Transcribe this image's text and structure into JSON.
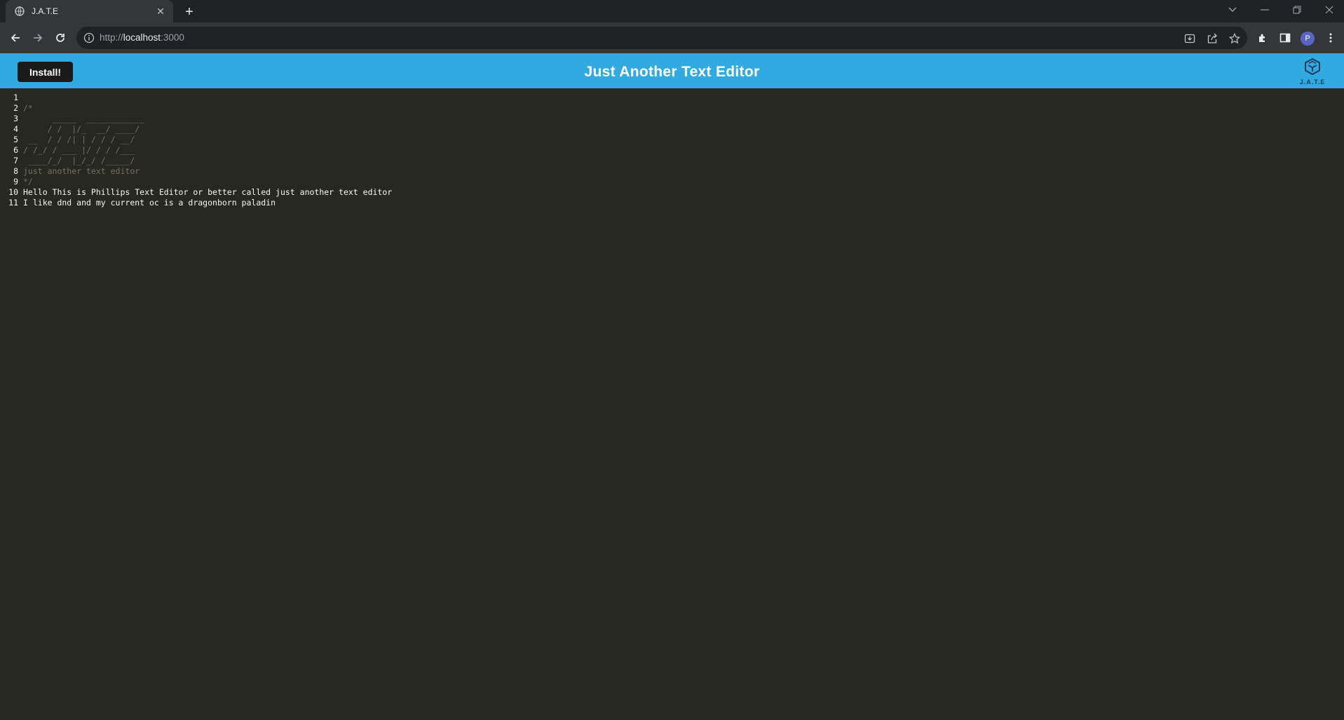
{
  "browser": {
    "tab_title": "J.A.T.E",
    "url_scheme": "http://",
    "url_host": "localhost",
    "url_port": ":3000",
    "profile_initial": "P"
  },
  "app": {
    "install_label": "Install!",
    "title": "Just Another Text Editor",
    "logo_text": "J.A.T.E"
  },
  "editor": {
    "lines": [
      {
        "num": "1",
        "text": "",
        "style": "normal"
      },
      {
        "num": "2",
        "text": "/*",
        "style": "comment"
      },
      {
        "num": "3",
        "text": "      _____  ____________",
        "style": "comment"
      },
      {
        "num": "4",
        "text": "     / /  |/_  __/ ____/",
        "style": "comment"
      },
      {
        "num": "5",
        "text": " __  / / /| | / / / __/",
        "style": "comment"
      },
      {
        "num": "6",
        "text": "/ /_/ / ___ |/ / / /___",
        "style": "comment"
      },
      {
        "num": "7",
        "text": " ____/_/  |_/_/ /_____/",
        "style": "comment"
      },
      {
        "num": "8",
        "text": "just another text editor",
        "style": "comment"
      },
      {
        "num": "9",
        "text": "*/",
        "style": "comment"
      },
      {
        "num": "10",
        "text": "Hello This is Phillips Text Editor or better called just another text editor",
        "style": "normal"
      },
      {
        "num": "11",
        "text": "I like dnd and my current oc is a dragonborn paladin",
        "style": "normal"
      }
    ]
  },
  "colors": {
    "header_bg": "#31a9e1",
    "editor_bg": "#272822",
    "comment": "#75715e",
    "text": "#f8f8f2"
  }
}
